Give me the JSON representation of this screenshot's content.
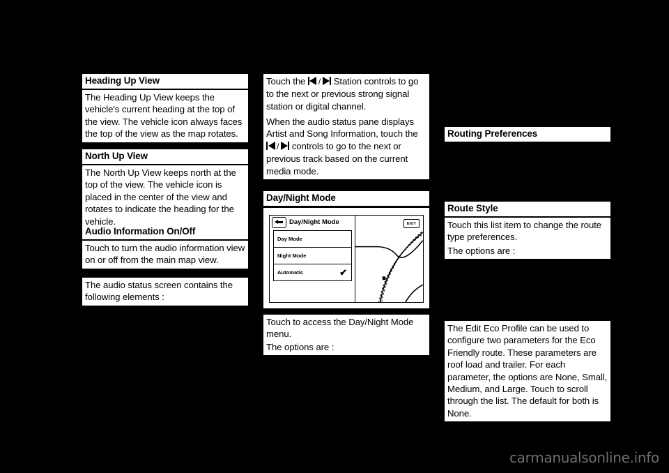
{
  "page": {
    "background_color": "#000000",
    "text_block_color": "#ffffff",
    "watermark": "carmanualsonline.info",
    "watermark_color": "#6f6f6f"
  },
  "left_column": {
    "heading_up_view": {
      "heading": "Heading Up View",
      "body": "The Heading Up View keeps the vehicle's current heading at the top of the view. The vehicle icon always faces the top of the view as the map rotates."
    },
    "north_up_view": {
      "heading": "North Up View",
      "body": "The North Up View keeps north at the top of the view. The vehicle icon is placed in the center of the view and rotates to indicate the heading for the vehicle."
    },
    "audio_information": {
      "heading": "Audio Information On/Off",
      "body1": "Touch to turn the audio information view on or off from the main map view.",
      "body2": "The audio status screen contains the following elements :"
    }
  },
  "middle_column": {
    "station_controls": {
      "text_before": "Touch the",
      "icon_prev": "previous-track-icon",
      "icon_sep": "/",
      "icon_next": "next-track-icon",
      "text_after": "Station controls to go to the next or previous strong signal station or digital channel."
    },
    "track_controls": {
      "text_before": "When the audio status pane displays Artist and Song Information, touch the",
      "icon_prev": "previous-track-icon",
      "icon_sep": "/",
      "icon_next": "next-track-icon",
      "text_after": "controls to go to the next or previous track based on the current media mode."
    },
    "day_night_mode": {
      "heading": "Day/Night Mode",
      "figure": {
        "screen_title": "Day/Night Mode",
        "back_icon": "back-arrow-icon",
        "exit_label": "EXIT",
        "options": [
          {
            "label": "Day Mode",
            "checked": false
          },
          {
            "label": "Night Mode",
            "checked": false
          },
          {
            "label": "Automatic",
            "checked": true
          }
        ],
        "check_glyph": "✔"
      },
      "body1": "Touch to access the Day/Night Mode menu.",
      "body2": "The options are :"
    }
  },
  "right_column": {
    "routing_preferences": {
      "heading": "Routing Preferences"
    },
    "route_style": {
      "heading": "Route Style",
      "body1": "Touch this list item to change the route type preferences.",
      "body2": "The options are :"
    },
    "eco_profile": {
      "body": "The Edit Eco Profile can be used to configure two parameters for the Eco Friendly route. These parameters are roof load and trailer. For each parameter, the options are None, Small, Medium, and Large. Touch to scroll through the list. The default for both is None."
    }
  }
}
